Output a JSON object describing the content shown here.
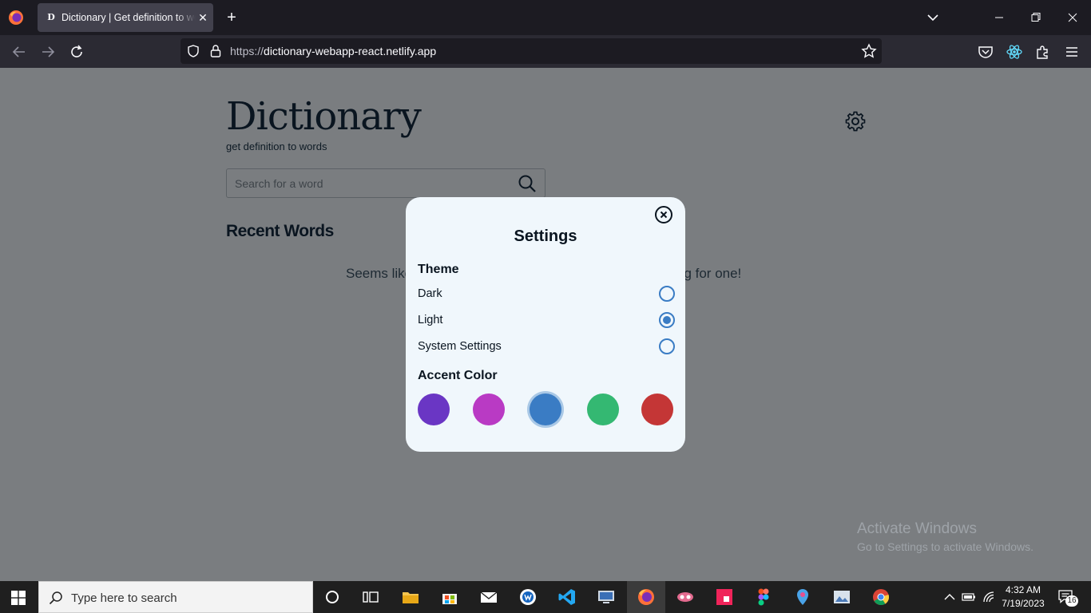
{
  "browser": {
    "tab_favicon": "D",
    "tab_title": "Dictionary | Get definition to words",
    "tab_close": "✕",
    "new_tab": "+",
    "url_scheme": "https://",
    "url_host": "dictionary-webapp-react.netlify.app"
  },
  "page": {
    "title": "Dictionary",
    "subtitle": "get definition to words",
    "search_placeholder": "Search for a word",
    "recent_heading": "Recent Words",
    "empty_message_left": "Seems like",
    "empty_message_right": "ng for one!"
  },
  "settings": {
    "title": "Settings",
    "theme_label": "Theme",
    "theme_options": [
      {
        "label": "Dark",
        "checked": false
      },
      {
        "label": "Light",
        "checked": true
      },
      {
        "label": "System Settings",
        "checked": false
      }
    ],
    "accent_label": "Accent Color",
    "accent_colors": [
      {
        "color": "#6a36c4",
        "selected": false
      },
      {
        "color": "#b93ac4",
        "selected": false
      },
      {
        "color": "#3a7cc4",
        "selected": true
      },
      {
        "color": "#34b872",
        "selected": false
      },
      {
        "color": "#c43636",
        "selected": false
      }
    ]
  },
  "watermark": {
    "title": "Activate Windows",
    "subtitle": "Go to Settings to activate Windows."
  },
  "taskbar": {
    "search_placeholder": "Type here to search",
    "time": "4:32 AM",
    "date": "7/19/2023",
    "notifications": "16"
  }
}
